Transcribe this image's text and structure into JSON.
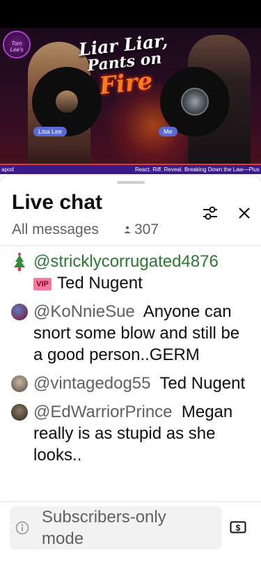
{
  "video": {
    "channel_logo_text": "Torn Lee's",
    "title_line1": "Liar Liar,",
    "title_line2": "Pants on",
    "title_line3": "Fire",
    "cam_left_label": "Lisa Lee",
    "cam_right_label": "Me",
    "ticker_left": "apod",
    "ticker_right": "React. Riff. Reveal. Breaking Down the Law—Plus"
  },
  "chat": {
    "title": "Live chat",
    "filter": "All messages",
    "viewer_count": "307",
    "messages": [
      {
        "author": "@stricklycorrugated4876",
        "badge": "VIP",
        "text": "Ted Nugent"
      },
      {
        "author": "@KoNnieSue",
        "text": "Anyone can snort some blow and still be a good person..GERM"
      },
      {
        "author": "@vintagedog55",
        "text": "Ted Nugent"
      },
      {
        "author": "@EdWarriorPrince",
        "text": "Megan really is as stupid as she looks.."
      }
    ],
    "footer_text": "Subscribers-only mode"
  },
  "icons": {
    "settings": "sliders-icon",
    "close": "close-icon",
    "info": "info-icon",
    "super_chat": "dollar-icon",
    "viewers": "person-icon"
  },
  "colors": {
    "member_author": "#2a7a30",
    "author": "#606060",
    "vip_badge": "#f07aa0",
    "live_bar": "#e53935"
  }
}
